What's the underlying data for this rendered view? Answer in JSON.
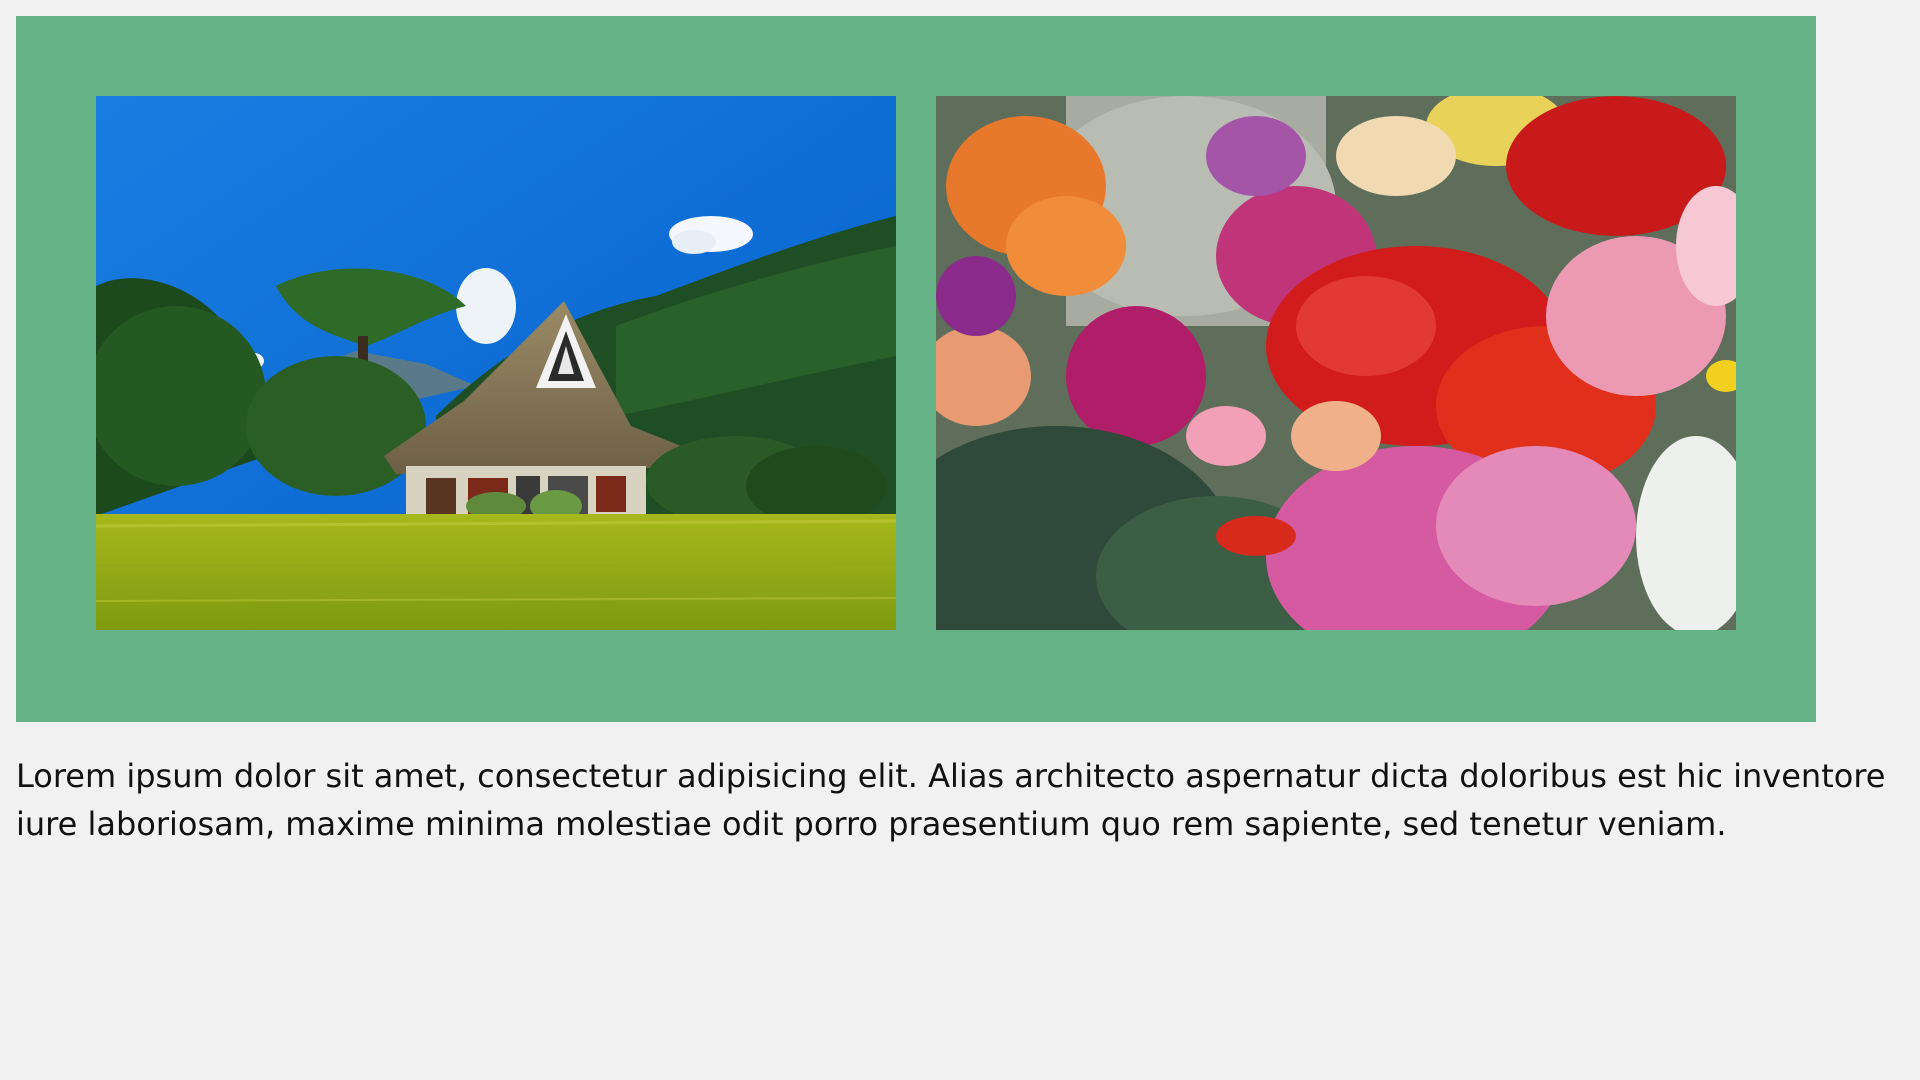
{
  "gallery": {
    "background_color": "#64b285",
    "images": [
      {
        "alt": "",
        "subject": "thatched-roof farmhouse in front of a rice field, forested mountains and blue sky",
        "icon": "landscape-photo"
      },
      {
        "alt": "",
        "subject": "close-up of colorful flower bed: red poinsettias, pink cyclamen, magenta stock, orange begonias",
        "icon": "flowers-photo"
      }
    ]
  },
  "text": {
    "paragraph": "Lorem ipsum dolor sit amet, consectetur adipisicing elit. Alias architecto aspernatur dicta doloribus est hic inventore iure laboriosam, maxime minima molestiae odit porro praesentium quo rem sapiente, sed tenetur veniam."
  },
  "colors": {
    "page_background": "#f1f1f1",
    "text": "#111111"
  }
}
